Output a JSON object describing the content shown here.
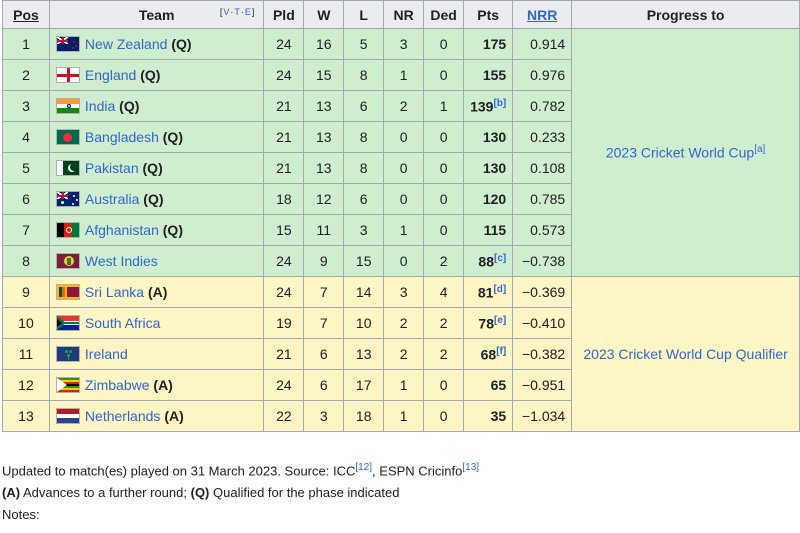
{
  "headers": {
    "pos": "Pos",
    "team": "Team",
    "vte": [
      "V",
      "T",
      "E"
    ],
    "pld": "Pld",
    "w": "W",
    "l": "L",
    "nr": "NR",
    "ded": "Ded",
    "pts": "Pts",
    "nrr": "NRR",
    "progress": "Progress to"
  },
  "rows": [
    {
      "pos": "1",
      "team": "New Zealand",
      "tag": "(Q)",
      "flag": "new-zealand-flag",
      "pld": "24",
      "w": "16",
      "l": "5",
      "nr": "3",
      "ded": "0",
      "pts": "175",
      "pts_note": "",
      "nrr": "0.914"
    },
    {
      "pos": "2",
      "team": "England",
      "tag": "(Q)",
      "flag": "england-flag",
      "pld": "24",
      "w": "15",
      "l": "8",
      "nr": "1",
      "ded": "0",
      "pts": "155",
      "pts_note": "",
      "nrr": "0.976"
    },
    {
      "pos": "3",
      "team": "India",
      "tag": "(Q)",
      "flag": "india-flag",
      "pld": "21",
      "w": "13",
      "l": "6",
      "nr": "2",
      "ded": "1",
      "pts": "139",
      "pts_note": "[b]",
      "nrr": "0.782"
    },
    {
      "pos": "4",
      "team": "Bangladesh",
      "tag": "(Q)",
      "flag": "bangladesh-flag",
      "pld": "21",
      "w": "13",
      "l": "8",
      "nr": "0",
      "ded": "0",
      "pts": "130",
      "pts_note": "",
      "nrr": "0.233"
    },
    {
      "pos": "5",
      "team": "Pakistan",
      "tag": "(Q)",
      "flag": "pakistan-flag",
      "pld": "21",
      "w": "13",
      "l": "8",
      "nr": "0",
      "ded": "0",
      "pts": "130",
      "pts_note": "",
      "nrr": "0.108"
    },
    {
      "pos": "6",
      "team": "Australia",
      "tag": "(Q)",
      "flag": "australia-flag",
      "pld": "18",
      "w": "12",
      "l": "6",
      "nr": "0",
      "ded": "0",
      "pts": "120",
      "pts_note": "",
      "nrr": "0.785"
    },
    {
      "pos": "7",
      "team": "Afghanistan",
      "tag": "(Q)",
      "flag": "afghanistan-flag",
      "pld": "15",
      "w": "11",
      "l": "3",
      "nr": "1",
      "ded": "0",
      "pts": "115",
      "pts_note": "",
      "nrr": "0.573"
    },
    {
      "pos": "8",
      "team": "West Indies",
      "tag": "",
      "flag": "west-indies-flag",
      "pld": "24",
      "w": "9",
      "l": "15",
      "nr": "0",
      "ded": "2",
      "pts": "88",
      "pts_note": "[c]",
      "nrr": "−0.738"
    },
    {
      "pos": "9",
      "team": "Sri Lanka",
      "tag": "(A)",
      "flag": "sri-lanka-flag",
      "pld": "24",
      "w": "7",
      "l": "14",
      "nr": "3",
      "ded": "4",
      "pts": "81",
      "pts_note": "[d]",
      "nrr": "−0.369"
    },
    {
      "pos": "10",
      "team": "South Africa",
      "tag": "",
      "flag": "south-africa-flag",
      "pld": "19",
      "w": "7",
      "l": "10",
      "nr": "2",
      "ded": "2",
      "pts": "78",
      "pts_note": "[e]",
      "nrr": "−0.410"
    },
    {
      "pos": "11",
      "team": "Ireland",
      "tag": "",
      "flag": "ireland-flag",
      "pld": "21",
      "w": "6",
      "l": "13",
      "nr": "2",
      "ded": "2",
      "pts": "68",
      "pts_note": "[f]",
      "nrr": "−0.382"
    },
    {
      "pos": "12",
      "team": "Zimbabwe",
      "tag": "(A)",
      "flag": "zimbabwe-flag",
      "pld": "24",
      "w": "6",
      "l": "17",
      "nr": "1",
      "ded": "0",
      "pts": "65",
      "pts_note": "",
      "nrr": "−0.951"
    },
    {
      "pos": "13",
      "team": "Netherlands",
      "tag": "(A)",
      "flag": "netherlands-flag",
      "pld": "22",
      "w": "3",
      "l": "18",
      "nr": "1",
      "ded": "0",
      "pts": "35",
      "pts_note": "",
      "nrr": "−1.034"
    }
  ],
  "progress": {
    "group1": {
      "label": "2023 Cricket World Cup",
      "note": "[a]",
      "color": "#cfeecf"
    },
    "group2": {
      "label": "2023 Cricket World Cup Qualifier",
      "note": "",
      "color": "#fbf6c4"
    }
  },
  "footer": {
    "updated_prefix": "Updated to match(es) played on 31 March 2023. Source: ",
    "source1": "ICC",
    "source1_ref": "[12]",
    "sep": ", ",
    "source2": "ESPN Cricinfo",
    "source2_ref": "[13]",
    "legend_a": "(A)",
    "legend_a_text": " Advances to a further round; ",
    "legend_q": "(Q)",
    "legend_q_text": " Qualified for the phase indicated",
    "notes_label": "Notes:"
  },
  "colors": {
    "link": "#3366cc",
    "header_bg": "#eaecf0",
    "border": "#a2a9b1"
  }
}
